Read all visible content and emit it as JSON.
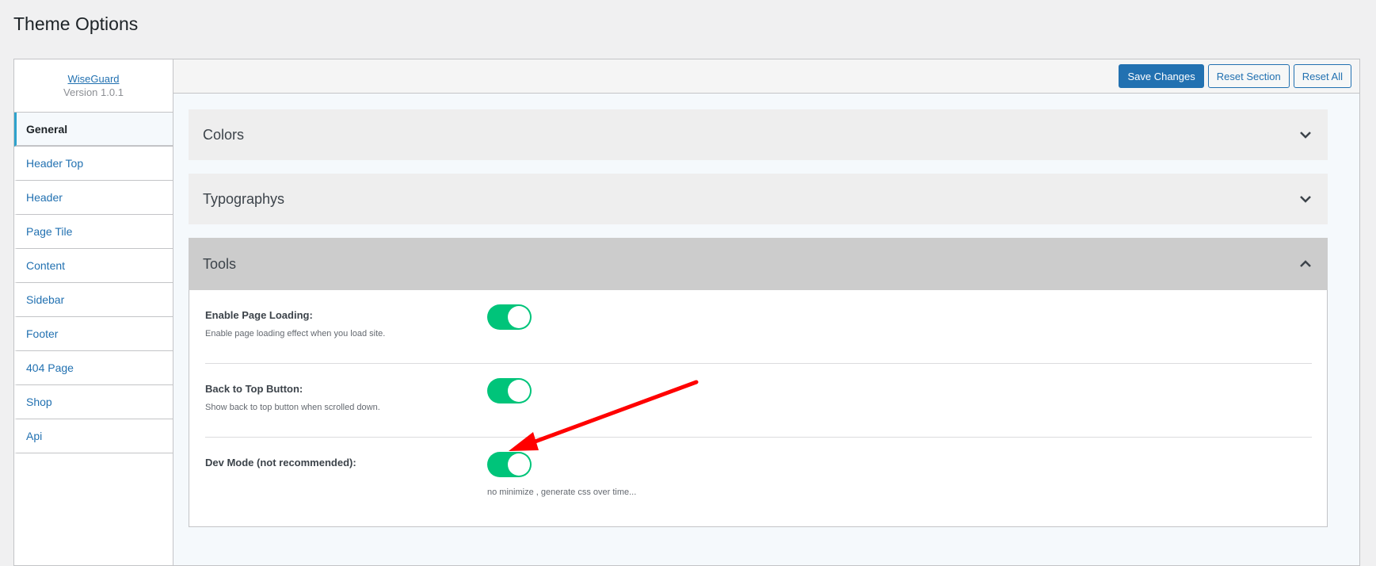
{
  "page": {
    "title": "Theme Options"
  },
  "brand": {
    "name": "WiseGuard",
    "version": "Version 1.0.1"
  },
  "sidebar": {
    "items": [
      {
        "label": "General",
        "active": true
      },
      {
        "label": "Header Top"
      },
      {
        "label": "Header"
      },
      {
        "label": "Page Tile"
      },
      {
        "label": "Content"
      },
      {
        "label": "Sidebar"
      },
      {
        "label": "Footer"
      },
      {
        "label": "404 Page"
      },
      {
        "label": "Shop"
      },
      {
        "label": "Api"
      }
    ]
  },
  "toolbar": {
    "save_label": "Save Changes",
    "reset_section_label": "Reset Section",
    "reset_all_label": "Reset All"
  },
  "sections": [
    {
      "title": "Colors",
      "expanded": false,
      "icon": "chevron-down-icon"
    },
    {
      "title": "Typographys",
      "expanded": false,
      "icon": "chevron-down-icon"
    },
    {
      "title": "Tools",
      "expanded": true,
      "icon": "chevron-up-icon"
    }
  ],
  "tools": {
    "options": [
      {
        "label": "Enable Page Loading:",
        "description": "Enable page loading effect when you load site.",
        "enabled": true
      },
      {
        "label": "Back to Top Button:",
        "description": "Show back to top button when scrolled down.",
        "enabled": true
      },
      {
        "label": "Dev Mode (not recommended):",
        "description": "no minimize , generate css over time...",
        "enabled": true
      }
    ]
  },
  "colors": {
    "accent": "#2271b1",
    "toggle_on": "#00c47a",
    "annotation_arrow": "#ff0000"
  }
}
